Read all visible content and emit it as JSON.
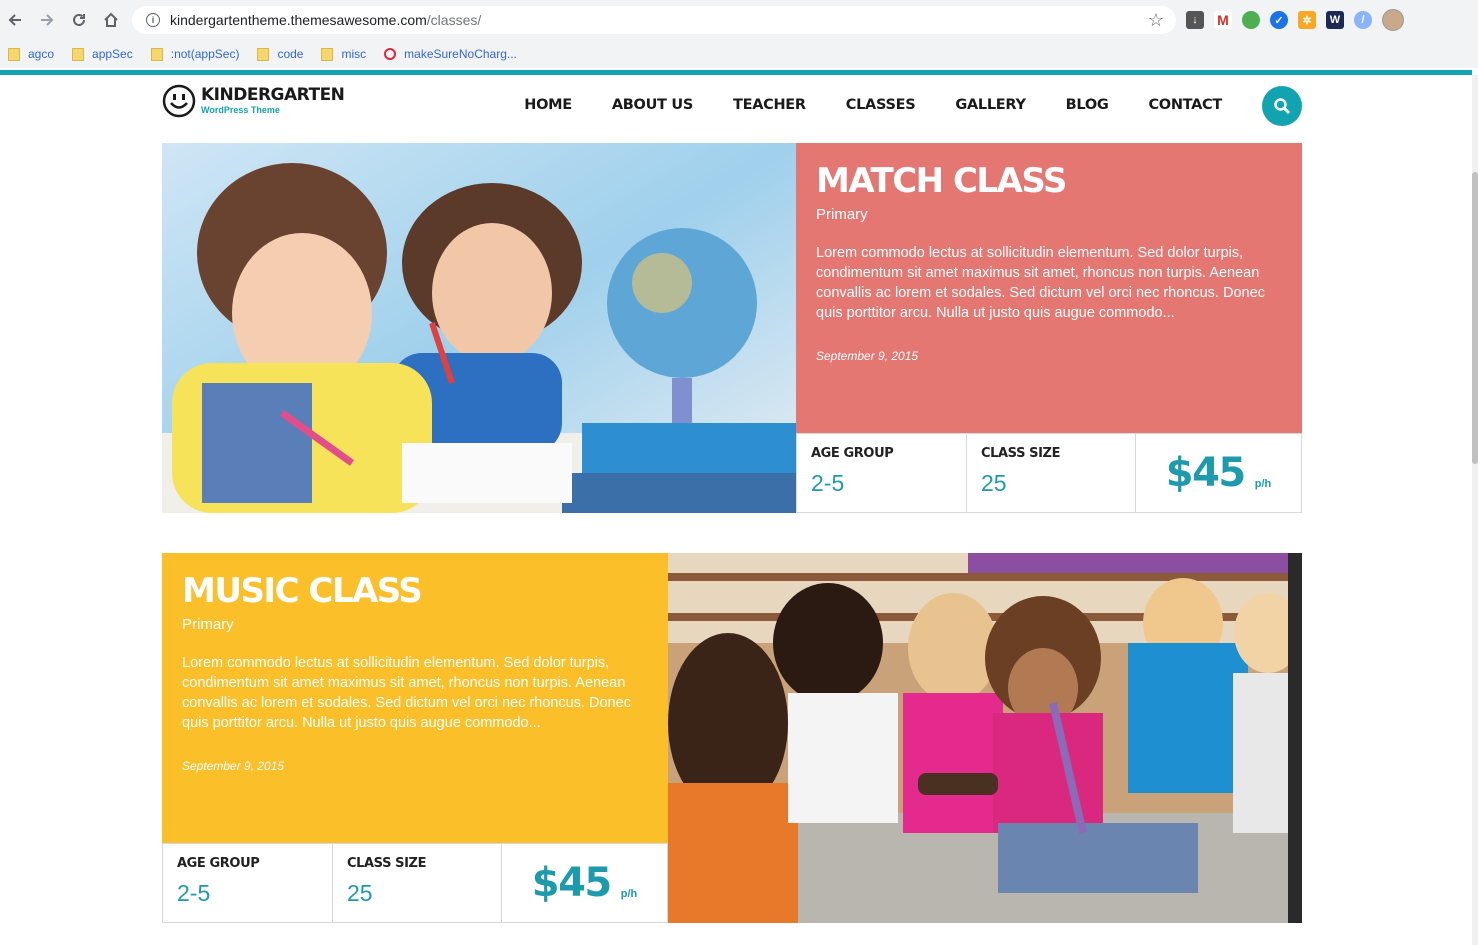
{
  "browser": {
    "url_host": "kindergartentheme.themesawesome.com",
    "url_path": "/classes/",
    "bookmarks": [
      {
        "label": "agco",
        "icon": "folder-icon"
      },
      {
        "label": "appSec",
        "icon": "folder-icon"
      },
      {
        "label": ":not(appSec)",
        "icon": "folder-icon"
      },
      {
        "label": "code",
        "icon": "folder-icon"
      },
      {
        "label": "misc",
        "icon": "folder-icon"
      },
      {
        "label": "makeSureNoCharg...",
        "icon": "opera-icon"
      }
    ]
  },
  "site": {
    "logo_title": "KINDERGARTEN",
    "logo_sub": "WordPress Theme",
    "nav": [
      "HOME",
      "ABOUT US",
      "TEACHER",
      "CLASSES",
      "GALLERY",
      "BLOG",
      "CONTACT"
    ],
    "accent": "#12a3b0"
  },
  "classes": [
    {
      "title": "MATCH CLASS",
      "level": "Primary",
      "description": "Lorem commodo lectus at sollicitudin elementum. Sed dolor turpis, condimentum sit amet maximus sit amet, rhoncus non turpis. Aenean convallis ac lorem et sodales. Sed dictum vel orci nec rhoncus. Donec quis porttitor arcu. Nulla ut justo quis augue commodo...",
      "date": "September 9, 2015",
      "age_group_label": "AGE GROUP",
      "age_group": "2-5",
      "class_size_label": "CLASS SIZE",
      "class_size": "25",
      "price": "$45",
      "price_unit": "p/h",
      "color": "#e57772"
    },
    {
      "title": "MUSIC CLASS",
      "level": "Primary",
      "description": "Lorem commodo lectus at sollicitudin elementum. Sed dolor turpis, condimentum sit amet maximus sit amet, rhoncus non turpis. Aenean convallis ac lorem et sodales. Sed dictum vel orci nec rhoncus. Donec quis porttitor arcu. Nulla ut justo quis augue commodo...",
      "date": "September 9, 2015",
      "age_group_label": "AGE GROUP",
      "age_group": "2-5",
      "class_size_label": "CLASS SIZE",
      "class_size": "25",
      "price": "$45",
      "price_unit": "p/h",
      "color": "#fbbf2a"
    }
  ]
}
